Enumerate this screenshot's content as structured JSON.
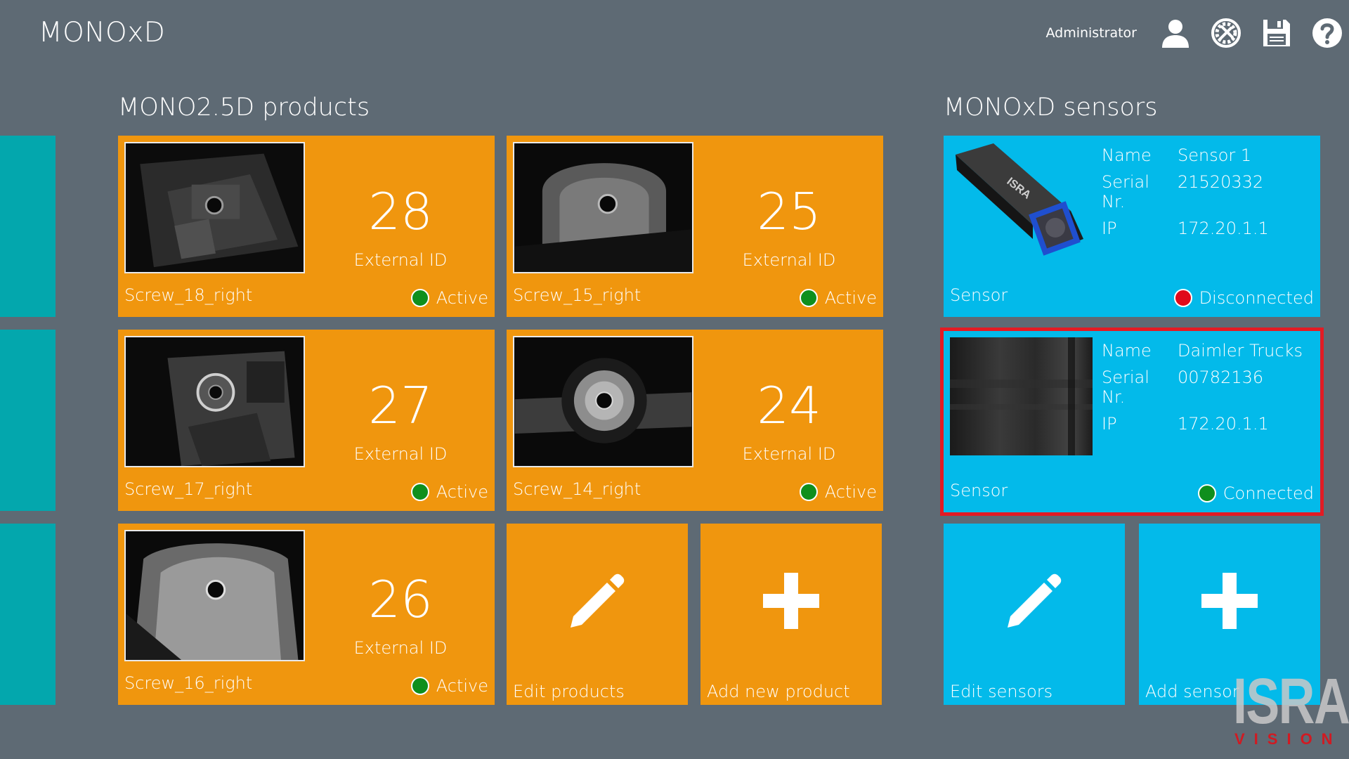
{
  "app": {
    "title": "MONOxD"
  },
  "topbar": {
    "user_name": "Administrator",
    "icons": [
      "user-icon",
      "tools-icon",
      "save-icon",
      "help-icon"
    ]
  },
  "products": {
    "title": "MONO2.5D products",
    "items": [
      {
        "name": "Screw_18_right",
        "number": "28",
        "caption": "External ID",
        "status": "Active"
      },
      {
        "name": "Screw_15_right",
        "number": "25",
        "caption": "External ID",
        "status": "Active"
      },
      {
        "name": "Screw_17_right",
        "number": "27",
        "caption": "External ID",
        "status": "Active"
      },
      {
        "name": "Screw_14_right",
        "number": "24",
        "caption": "External ID",
        "status": "Active"
      },
      {
        "name": "Screw_16_right",
        "number": "26",
        "caption": "External ID",
        "status": "Active"
      }
    ],
    "edit_label": "Edit products",
    "add_label": "Add new product"
  },
  "sensors": {
    "title": "MONOxD sensors",
    "field_labels": {
      "name": "Name",
      "serial": "Serial Nr.",
      "ip": "IP"
    },
    "items": [
      {
        "label": "Sensor",
        "name": "Sensor 1",
        "serial": "21520332",
        "ip": "172.20.1.1",
        "status": "Disconnected",
        "status_color": "#e00a1a"
      },
      {
        "label": "Sensor",
        "name": "Daimler Trucks",
        "serial": "00782136",
        "ip": "172.20.1.1",
        "status": "Connected",
        "status_color": "#0f8f1d"
      }
    ],
    "edit_label": "Edit sensors",
    "add_label": "Add sensor"
  },
  "brand": {
    "name": "ISRA",
    "sub": "VISION"
  },
  "colors": {
    "background": "#5e6a74",
    "product_tile": "#f0960e",
    "sensor_tile": "#03baea",
    "side_strip": "#03a7ad",
    "highlight": "#e31b23"
  }
}
